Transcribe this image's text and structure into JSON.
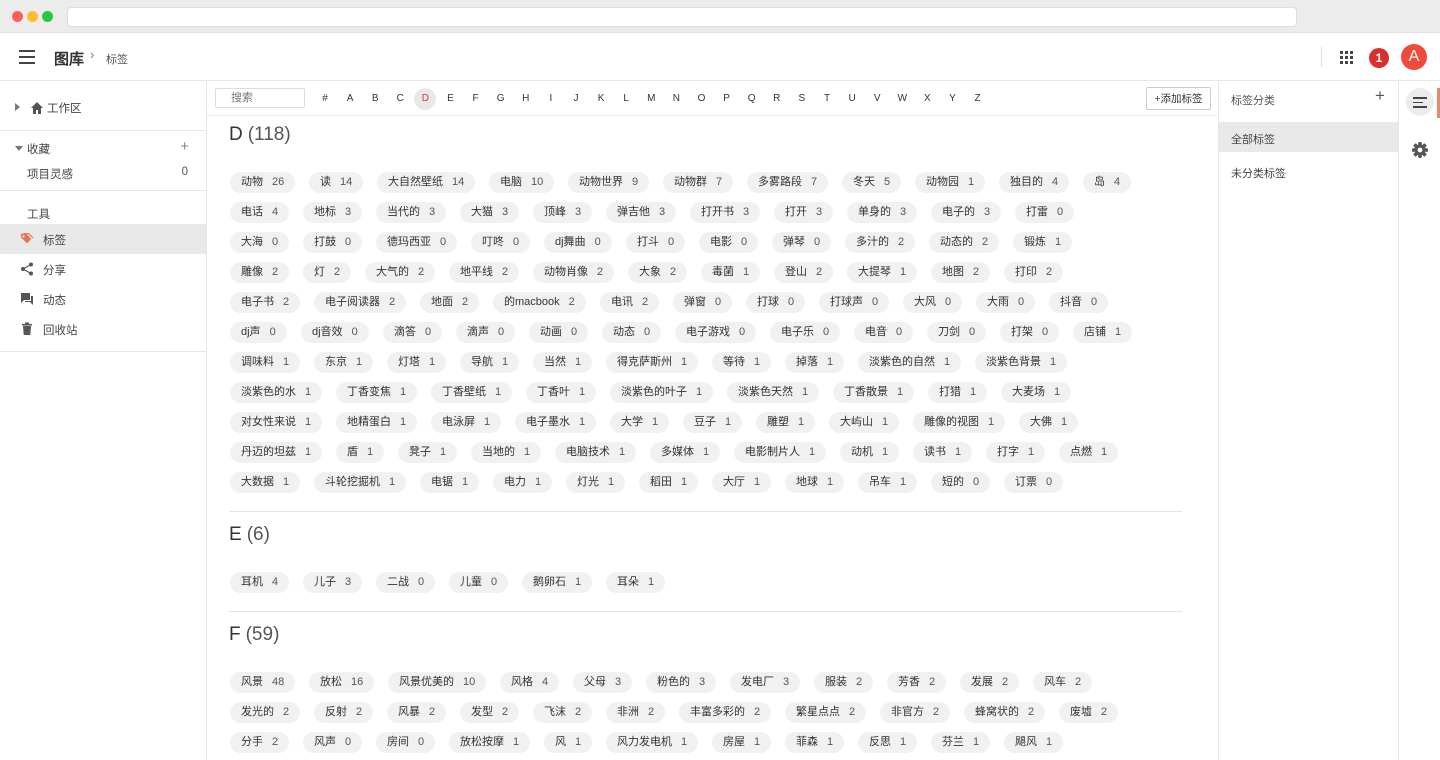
{
  "header": {
    "breadcrumb_root": "图库",
    "breadcrumb_sep": "›",
    "breadcrumb_current": "标签",
    "notification_count": "1",
    "avatar_letter": "A"
  },
  "sidebar": {
    "workspace": "工作区",
    "favorites": "收藏",
    "favorites_add": "+",
    "favorite_items": [
      {
        "label": "项目灵感",
        "count": "0"
      }
    ],
    "tools_label": "工具",
    "tools": [
      {
        "label": "标签",
        "icon": "tag-icon"
      },
      {
        "label": "分享",
        "icon": "share-icon"
      },
      {
        "label": "动态",
        "icon": "chat-icon"
      },
      {
        "label": "回收站",
        "icon": "trash-icon"
      }
    ]
  },
  "filter": {
    "search_placeholder": "搜索",
    "letters": [
      "#",
      "A",
      "B",
      "C",
      "D",
      "E",
      "F",
      "G",
      "H",
      "I",
      "J",
      "K",
      "L",
      "M",
      "N",
      "O",
      "P",
      "Q",
      "R",
      "S",
      "T",
      "U",
      "V",
      "W",
      "X",
      "Y",
      "Z"
    ],
    "active_letter": "D",
    "add_tag_label": "+添加标签"
  },
  "sections": [
    {
      "letter": "D",
      "count": "(118)",
      "rows": [
        [
          [
            "动物",
            "26"
          ],
          [
            "读",
            "14"
          ],
          [
            "大自然壁纸",
            "14"
          ],
          [
            "电脑",
            "10"
          ],
          [
            "动物世界",
            "9"
          ],
          [
            "动物群",
            "7"
          ],
          [
            "多雾路段",
            "7"
          ],
          [
            "冬天",
            "5"
          ],
          [
            "动物园",
            "1"
          ],
          [
            "独目的",
            "4"
          ],
          [
            "岛",
            "4"
          ]
        ],
        [
          [
            "电话",
            "4"
          ],
          [
            "地标",
            "3"
          ],
          [
            "当代的",
            "3"
          ],
          [
            "大猫",
            "3"
          ],
          [
            "顶峰",
            "3"
          ],
          [
            "弹吉他",
            "3"
          ],
          [
            "打开书",
            "3"
          ],
          [
            "打开",
            "3"
          ],
          [
            "单身的",
            "3"
          ],
          [
            "电子的",
            "3"
          ],
          [
            "打雷",
            "0"
          ]
        ],
        [
          [
            "大海",
            "0"
          ],
          [
            "打鼓",
            "0"
          ],
          [
            "德玛西亚",
            "0"
          ],
          [
            "叮咚",
            "0"
          ],
          [
            "dj舞曲",
            "0"
          ],
          [
            "打斗",
            "0"
          ],
          [
            "电影",
            "0"
          ],
          [
            "弹琴",
            "0"
          ],
          [
            "多汁的",
            "2"
          ],
          [
            "动态的",
            "2"
          ],
          [
            "锻炼",
            "1"
          ]
        ],
        [
          [
            "雕像",
            "2"
          ],
          [
            "灯",
            "2"
          ],
          [
            "大气的",
            "2"
          ],
          [
            "地平线",
            "2"
          ],
          [
            "动物肖像",
            "2"
          ],
          [
            "大象",
            "2"
          ],
          [
            "毒菌",
            "1"
          ],
          [
            "登山",
            "2"
          ],
          [
            "大提琴",
            "1"
          ],
          [
            "地图",
            "2"
          ],
          [
            "打印",
            "2"
          ]
        ],
        [
          [
            "电子书",
            "2"
          ],
          [
            "电子阅读器",
            "2"
          ],
          [
            "地面",
            "2"
          ],
          [
            "的macbook",
            "2"
          ],
          [
            "电讯",
            "2"
          ],
          [
            "弹窗",
            "0"
          ],
          [
            "打球",
            "0"
          ],
          [
            "打球声",
            "0"
          ],
          [
            "大风",
            "0"
          ],
          [
            "大雨",
            "0"
          ],
          [
            "抖音",
            "0"
          ]
        ],
        [
          [
            "dj声",
            "0"
          ],
          [
            "dj音效",
            "0"
          ],
          [
            "滴答",
            "0"
          ],
          [
            "滴声",
            "0"
          ],
          [
            "动画",
            "0"
          ],
          [
            "动态",
            "0"
          ],
          [
            "电子游戏",
            "0"
          ],
          [
            "电子乐",
            "0"
          ],
          [
            "电音",
            "0"
          ],
          [
            "刀剑",
            "0"
          ],
          [
            "打架",
            "0"
          ],
          [
            "店铺",
            "1"
          ]
        ],
        [
          [
            "调味料",
            "1"
          ],
          [
            "东京",
            "1"
          ],
          [
            "灯塔",
            "1"
          ],
          [
            "导航",
            "1"
          ],
          [
            "当然",
            "1"
          ],
          [
            "得克萨斯州",
            "1"
          ],
          [
            "等待",
            "1"
          ],
          [
            "掉落",
            "1"
          ],
          [
            "淡紫色的自然",
            "1"
          ],
          [
            "淡紫色背景",
            "1"
          ]
        ],
        [
          [
            "淡紫色的水",
            "1"
          ],
          [
            "丁香变焦",
            "1"
          ],
          [
            "丁香壁纸",
            "1"
          ],
          [
            "丁香叶",
            "1"
          ],
          [
            "淡紫色的叶子",
            "1"
          ],
          [
            "淡紫色天然",
            "1"
          ],
          [
            "丁香散景",
            "1"
          ],
          [
            "打猎",
            "1"
          ],
          [
            "大麦场",
            "1"
          ]
        ],
        [
          [
            "对女性来说",
            "1"
          ],
          [
            "地精蛋白",
            "1"
          ],
          [
            "电泳屏",
            "1"
          ],
          [
            "电子墨水",
            "1"
          ],
          [
            "大学",
            "1"
          ],
          [
            "豆子",
            "1"
          ],
          [
            "雕塑",
            "1"
          ],
          [
            "大屿山",
            "1"
          ],
          [
            "雕像的视图",
            "1"
          ],
          [
            "大佛",
            "1"
          ]
        ],
        [
          [
            "丹迈的坦兹",
            "1"
          ],
          [
            "盾",
            "1"
          ],
          [
            "凳子",
            "1"
          ],
          [
            "当地的",
            "1"
          ],
          [
            "电脑技术",
            "1"
          ],
          [
            "多媒体",
            "1"
          ],
          [
            "电影制片人",
            "1"
          ],
          [
            "动机",
            "1"
          ],
          [
            "读书",
            "1"
          ],
          [
            "打字",
            "1"
          ],
          [
            "点燃",
            "1"
          ]
        ],
        [
          [
            "大数据",
            "1"
          ],
          [
            "斗轮挖掘机",
            "1"
          ],
          [
            "电锯",
            "1"
          ],
          [
            "电力",
            "1"
          ],
          [
            "灯光",
            "1"
          ],
          [
            "稻田",
            "1"
          ],
          [
            "大厅",
            "1"
          ],
          [
            "地球",
            "1"
          ],
          [
            "吊车",
            "1"
          ],
          [
            "短的",
            "0"
          ],
          [
            "订票",
            "0"
          ]
        ]
      ]
    },
    {
      "letter": "E",
      "count": "(6)",
      "rows": [
        [
          [
            "耳机",
            "4"
          ],
          [
            "儿子",
            "3"
          ],
          [
            "二战",
            "0"
          ],
          [
            "儿童",
            "0"
          ],
          [
            "鹅卵石",
            "1"
          ],
          [
            "耳朵",
            "1"
          ]
        ]
      ]
    },
    {
      "letter": "F",
      "count": "(59)",
      "rows": [
        [
          [
            "风景",
            "48"
          ],
          [
            "放松",
            "16"
          ],
          [
            "风景优美的",
            "10"
          ],
          [
            "风格",
            "4"
          ],
          [
            "父母",
            "3"
          ],
          [
            "粉色的",
            "3"
          ],
          [
            "发电厂",
            "3"
          ],
          [
            "服装",
            "2"
          ],
          [
            "芳香",
            "2"
          ],
          [
            "发展",
            "2"
          ],
          [
            "风车",
            "2"
          ]
        ],
        [
          [
            "发光的",
            "2"
          ],
          [
            "反射",
            "2"
          ],
          [
            "风暴",
            "2"
          ],
          [
            "发型",
            "2"
          ],
          [
            "飞沫",
            "2"
          ],
          [
            "非洲",
            "2"
          ],
          [
            "丰富多彩的",
            "2"
          ],
          [
            "繁星点点",
            "2"
          ],
          [
            "非官方",
            "2"
          ],
          [
            "蜂窝状的",
            "2"
          ],
          [
            "废墟",
            "2"
          ]
        ],
        [
          [
            "分手",
            "2"
          ],
          [
            "风声",
            "0"
          ],
          [
            "房间",
            "0"
          ],
          [
            "放松按摩",
            "1"
          ],
          [
            "风",
            "1"
          ],
          [
            "风力发电机",
            "1"
          ],
          [
            "房屋",
            "1"
          ],
          [
            "菲森",
            "1"
          ],
          [
            "反思",
            "1"
          ],
          [
            "芬兰",
            "1"
          ],
          [
            "飓风",
            "1"
          ]
        ]
      ]
    }
  ],
  "right_panel": {
    "title": "标签分类",
    "add": "+",
    "items": [
      "全部标签",
      "未分类标签"
    ]
  },
  "colors": {
    "accent": "#d23c3c",
    "badge": "#d8302f",
    "avatar": "#ee4b3b"
  }
}
